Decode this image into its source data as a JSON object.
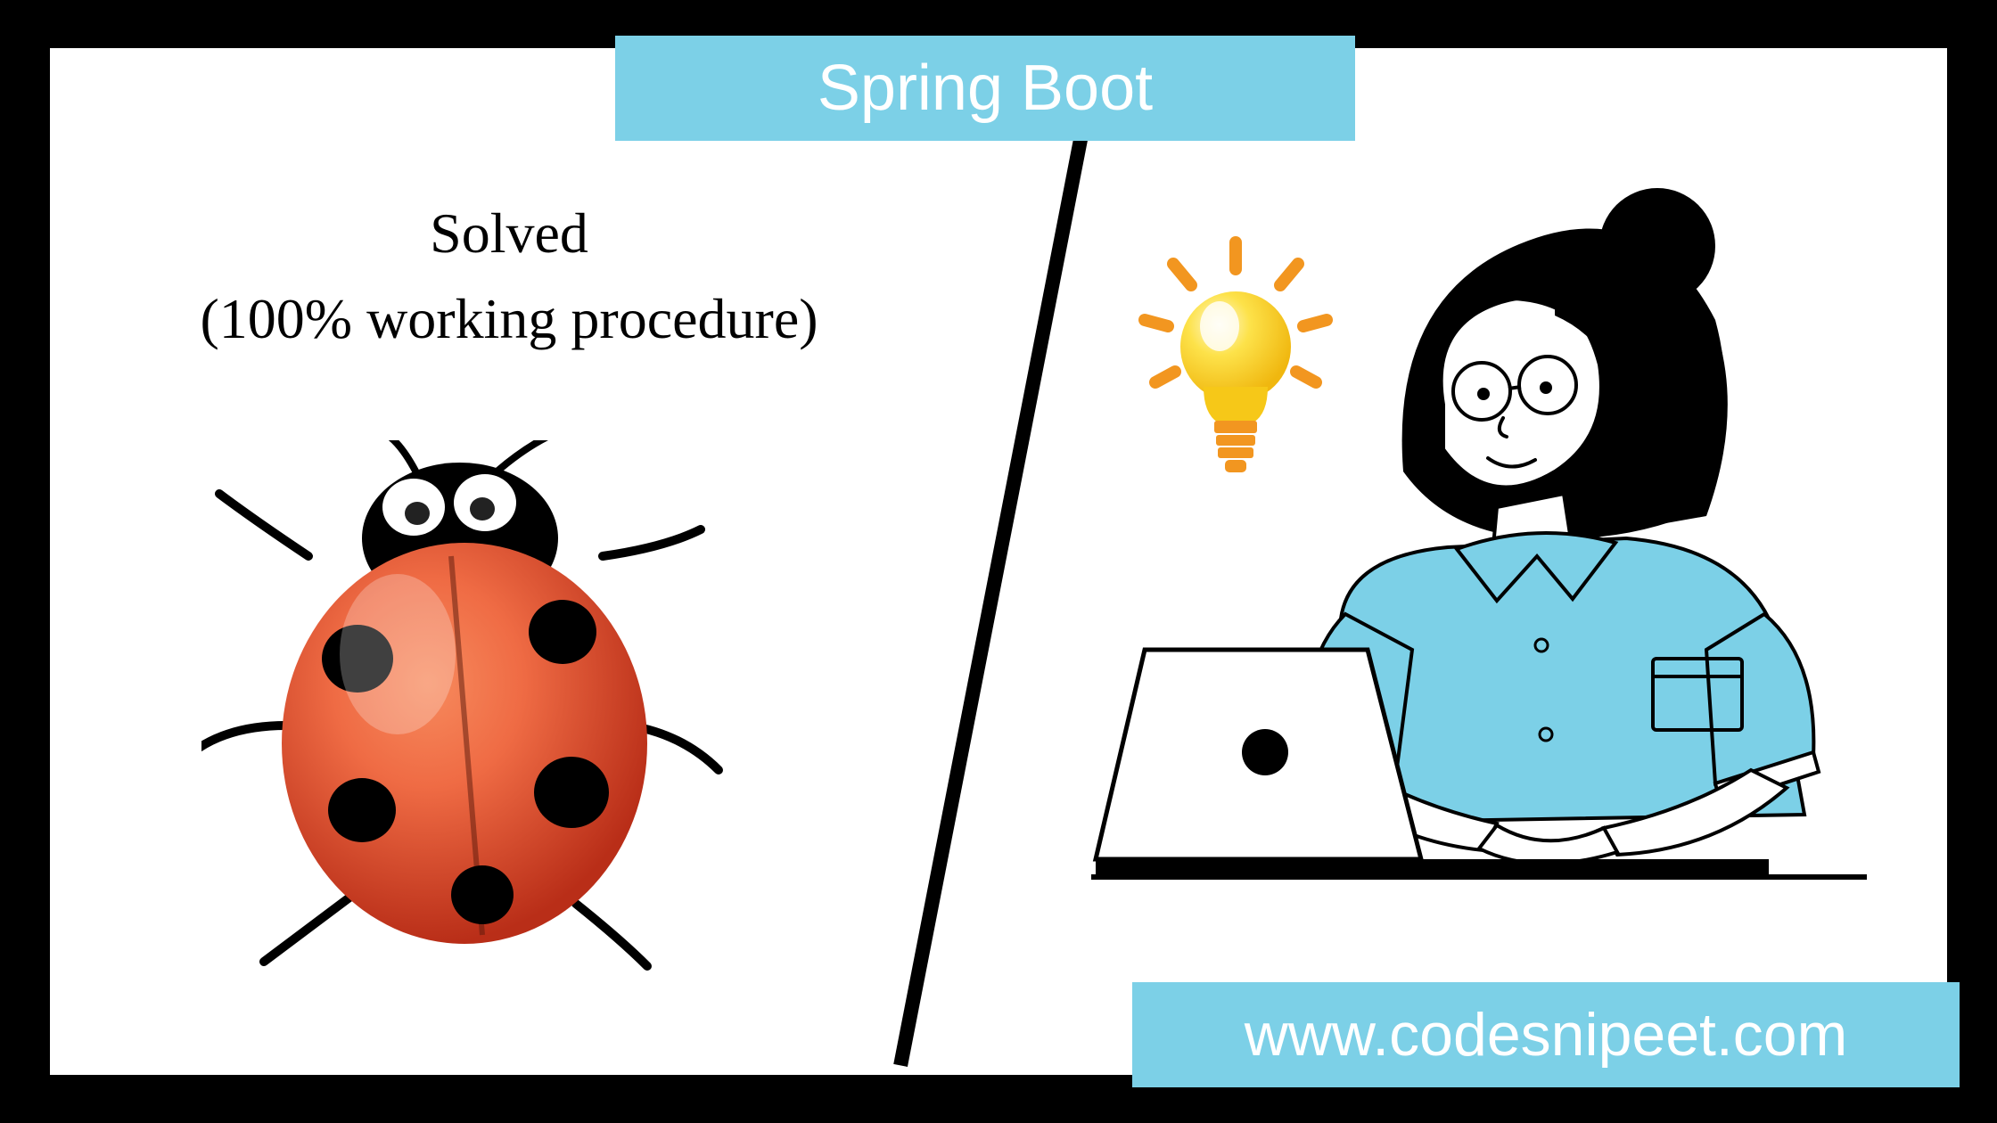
{
  "banner": {
    "top": "Spring Boot",
    "bottom": "www.codesnipeet.com"
  },
  "title": {
    "line1": "Solved",
    "line2": "(100% working procedure)"
  },
  "colors": {
    "accent": "#7cd0e7",
    "bug_red": "#e8593b",
    "bulb_yellow": "#f9d023",
    "bulb_orange": "#f29620",
    "shirt": "#7cd0e7"
  },
  "icons": {
    "ladybug": "ladybug-icon",
    "lightbulb": "lightbulb-icon",
    "person": "person-at-laptop-icon"
  }
}
